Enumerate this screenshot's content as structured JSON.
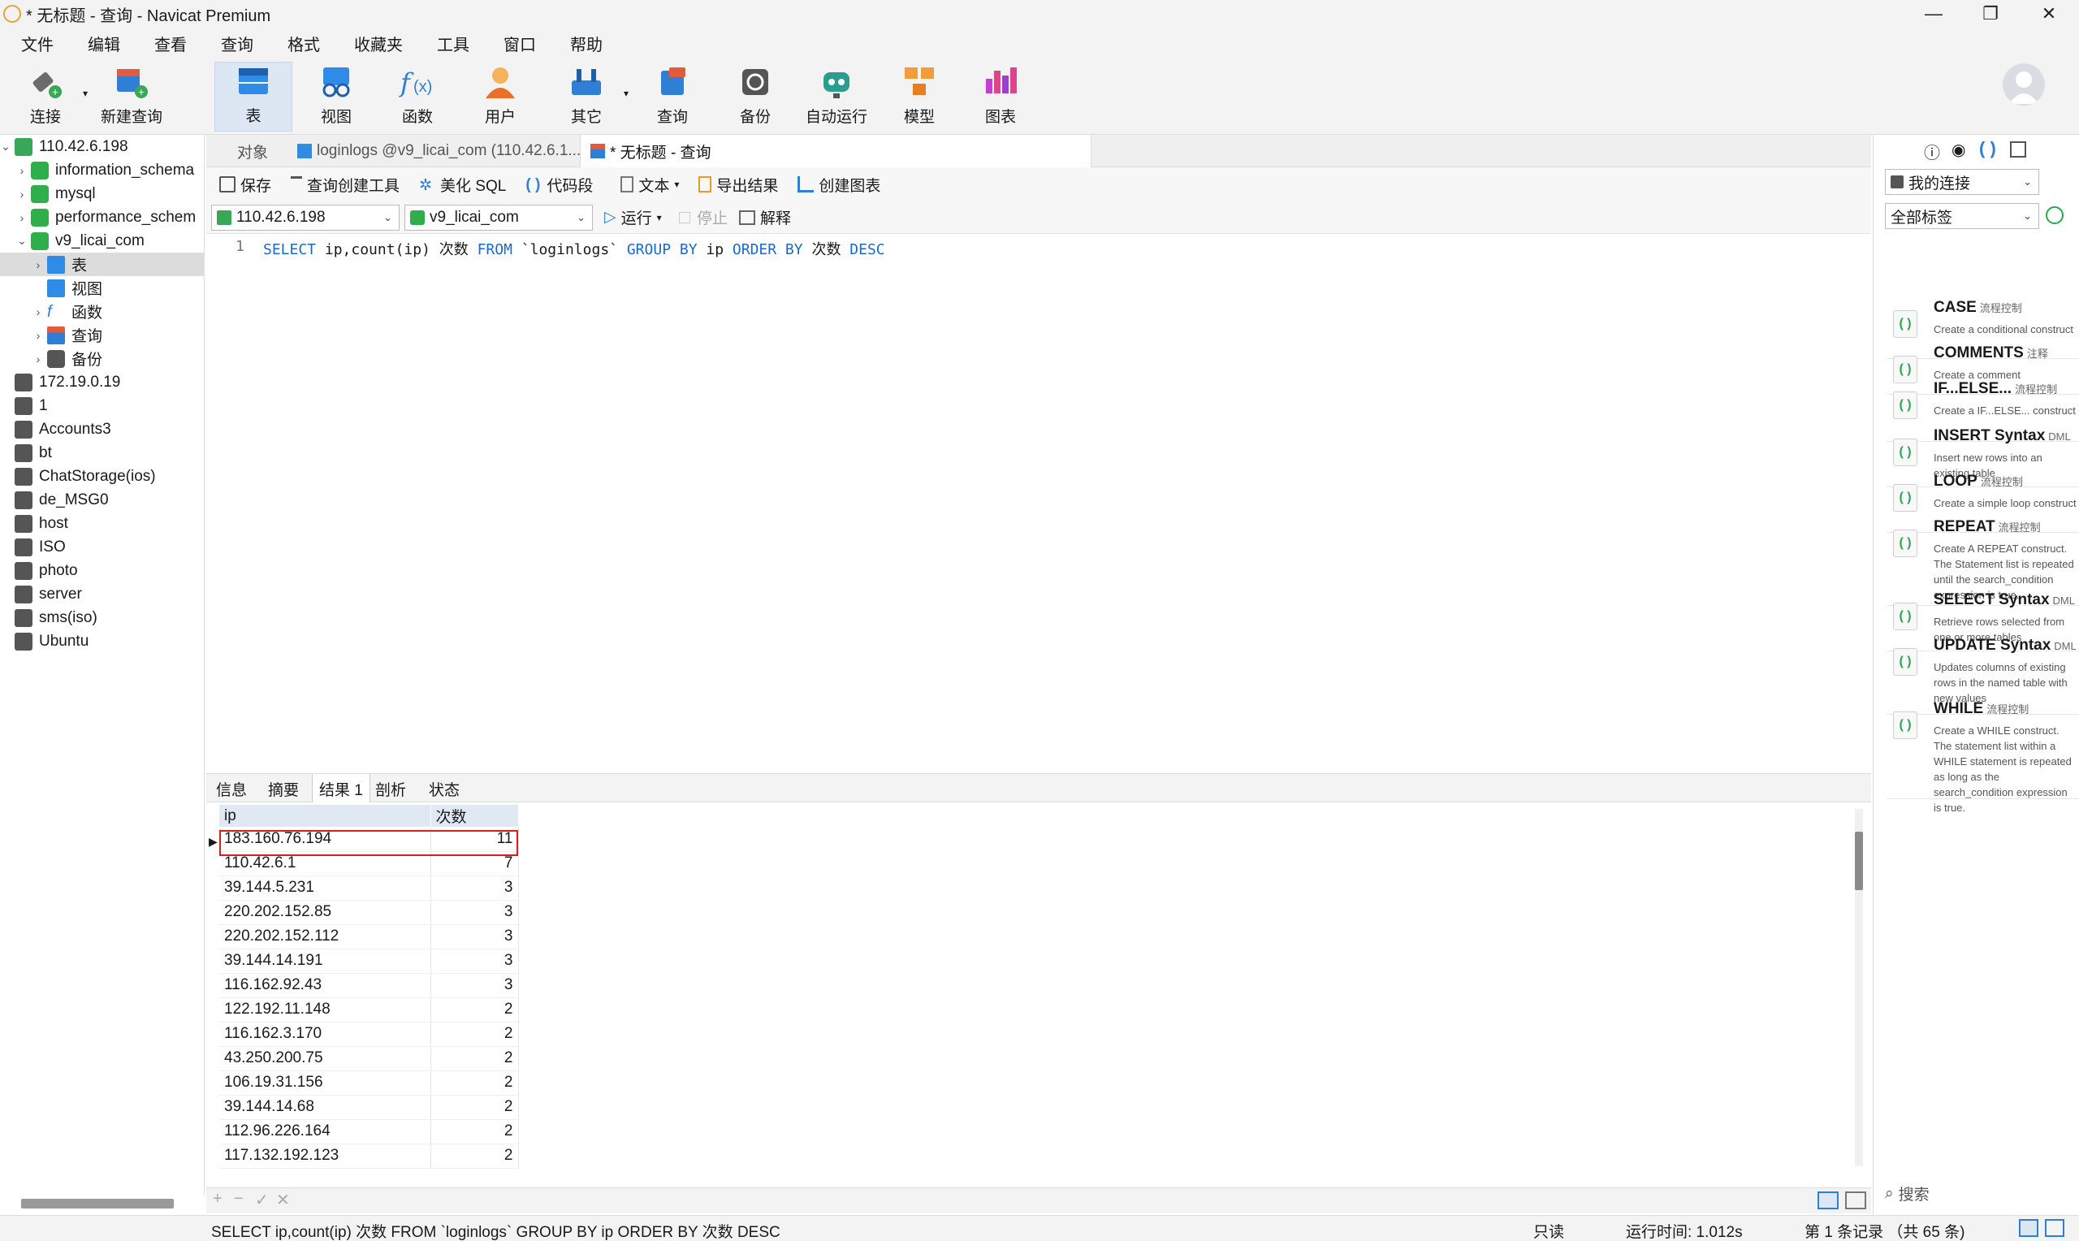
{
  "window": {
    "title": "* 无标题 - 查询 - Navicat Premium"
  },
  "menu": [
    "文件",
    "编辑",
    "查看",
    "查询",
    "格式",
    "收藏夹",
    "工具",
    "窗口",
    "帮助"
  ],
  "toolbar": {
    "items": [
      {
        "label": "连接",
        "icon": "connect-icon"
      },
      {
        "label": "新建查询",
        "icon": "new-query-icon"
      },
      {
        "label": "表",
        "icon": "table-icon"
      },
      {
        "label": "视图",
        "icon": "view-icon"
      },
      {
        "label": "函数",
        "icon": "function-icon"
      },
      {
        "label": "用户",
        "icon": "user-icon"
      },
      {
        "label": "其它",
        "icon": "other-icon"
      },
      {
        "label": "查询",
        "icon": "query-icon"
      },
      {
        "label": "备份",
        "icon": "backup-icon"
      },
      {
        "label": "自动运行",
        "icon": "auto-run-icon"
      },
      {
        "label": "模型",
        "icon": "model-icon"
      },
      {
        "label": "图表",
        "icon": "chart-icon"
      }
    ]
  },
  "sidebar": {
    "connection": "110.42.6.198",
    "databases": [
      "information_schema",
      "mysql",
      "performance_schem",
      "v9_licai_com"
    ],
    "db_children": [
      "表",
      "视图",
      "函数",
      "查询",
      "备份"
    ],
    "connections": [
      "172.19.0.19",
      "1",
      "Accounts3",
      "bt",
      "ChatStorage(ios)",
      "de_MSG0",
      "host",
      "ISO",
      "photo",
      "server",
      "sms(iso)",
      "Ubuntu"
    ]
  },
  "tabs": {
    "objects": "对象",
    "loginlogs": "loginlogs @v9_licai_com (110.42.6.1...",
    "query": "* 无标题 - 查询"
  },
  "query_toolbar": {
    "save": "保存",
    "builder": "查询创建工具",
    "beautify": "美化 SQL",
    "snippet": "代码段",
    "text": "文本",
    "export": "导出结果",
    "chart": "创建图表"
  },
  "selectors": {
    "connection": "110.42.6.198",
    "database": "v9_licai_com",
    "run": "运行",
    "stop": "停止",
    "explain": "解释"
  },
  "editor": {
    "line": "1",
    "sql": "SELECT ip,count(ip) 次数 FROM `loginlogs` GROUP BY ip ORDER BY 次数 DESC"
  },
  "result_tabs": [
    "信息",
    "摘要",
    "结果 1",
    "剖析",
    "状态"
  ],
  "grid": {
    "columns": [
      "ip",
      "次数"
    ],
    "rows": [
      [
        "183.160.76.194",
        "11"
      ],
      [
        "110.42.6.1",
        "7"
      ],
      [
        "39.144.5.231",
        "3"
      ],
      [
        "220.202.152.85",
        "3"
      ],
      [
        "220.202.152.112",
        "3"
      ],
      [
        "39.144.14.191",
        "3"
      ],
      [
        "116.162.92.43",
        "3"
      ],
      [
        "122.192.11.148",
        "2"
      ],
      [
        "116.162.3.170",
        "2"
      ],
      [
        "43.250.200.75",
        "2"
      ],
      [
        "106.19.31.156",
        "2"
      ],
      [
        "39.144.14.68",
        "2"
      ],
      [
        "112.96.226.164",
        "2"
      ],
      [
        "117.132.192.123",
        "2"
      ]
    ]
  },
  "right_panel": {
    "connection_filter": "我的连接",
    "tag_filter": "全部标签",
    "search_placeholder": "搜索",
    "snippets": [
      {
        "name": "CASE",
        "cat": "流程控制",
        "desc": "Create a conditional construct"
      },
      {
        "name": "COMMENTS",
        "cat": "注释",
        "desc": "Create a comment"
      },
      {
        "name": "IF...ELSE...",
        "cat": "流程控制",
        "desc": "Create a IF...ELSE... construct"
      },
      {
        "name": "INSERT Syntax",
        "cat": "DML",
        "desc": "Insert new rows into an existing table"
      },
      {
        "name": "LOOP",
        "cat": "流程控制",
        "desc": "Create a simple loop construct"
      },
      {
        "name": "REPEAT",
        "cat": "流程控制",
        "desc": "Create A REPEAT construct. The Statement list is repeated until the search_condition expression is true."
      },
      {
        "name": "SELECT Syntax",
        "cat": "DML",
        "desc": "Retrieve rows selected from one or more tables"
      },
      {
        "name": "UPDATE Syntax",
        "cat": "DML",
        "desc": "Updates columns of existing rows in the named table with new values"
      },
      {
        "name": "WHILE",
        "cat": "流程控制",
        "desc": "Create a WHILE construct. The statement list within a WHILE statement is repeated as long as the search_condition expression is true."
      }
    ]
  },
  "status": {
    "sql": "SELECT ip,count(ip) 次数 FROM `loginlogs` GROUP BY ip ORDER BY 次数 DESC",
    "readonly": "只读",
    "time": "运行时间: 1.012s",
    "records": "第 1 条记录 （共 65 条)"
  },
  "colors": {
    "accent": "#1b6ac9",
    "highlight": "#d32020",
    "selected_toolbar": "#dce7f3"
  }
}
